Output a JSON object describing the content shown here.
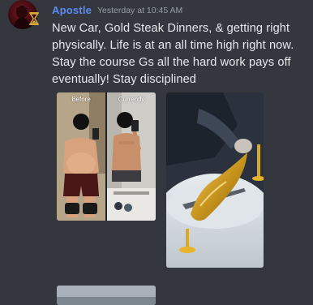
{
  "message": {
    "author": "Apostle",
    "author_color": "#5b8df5",
    "timestamp": "Yesterday at 10:45 AM",
    "text": "New Car, Gold Steak Dinners, & getting right physically. Life is at an all time high right now. Stay the course Gs all the hard work pays off eventually! Stay disciplined",
    "role_icon": "gold-hourglass-icon"
  },
  "attachments": {
    "before_after": {
      "before_label": "Before",
      "after_label": "Currently"
    },
    "gold_steak": {
      "icon": "gold-leaf-steak-image"
    }
  },
  "colors": {
    "background": "#34373d",
    "text": "#e8e9ec",
    "muted": "#9a9ea6",
    "gold": "#d4a83a"
  }
}
